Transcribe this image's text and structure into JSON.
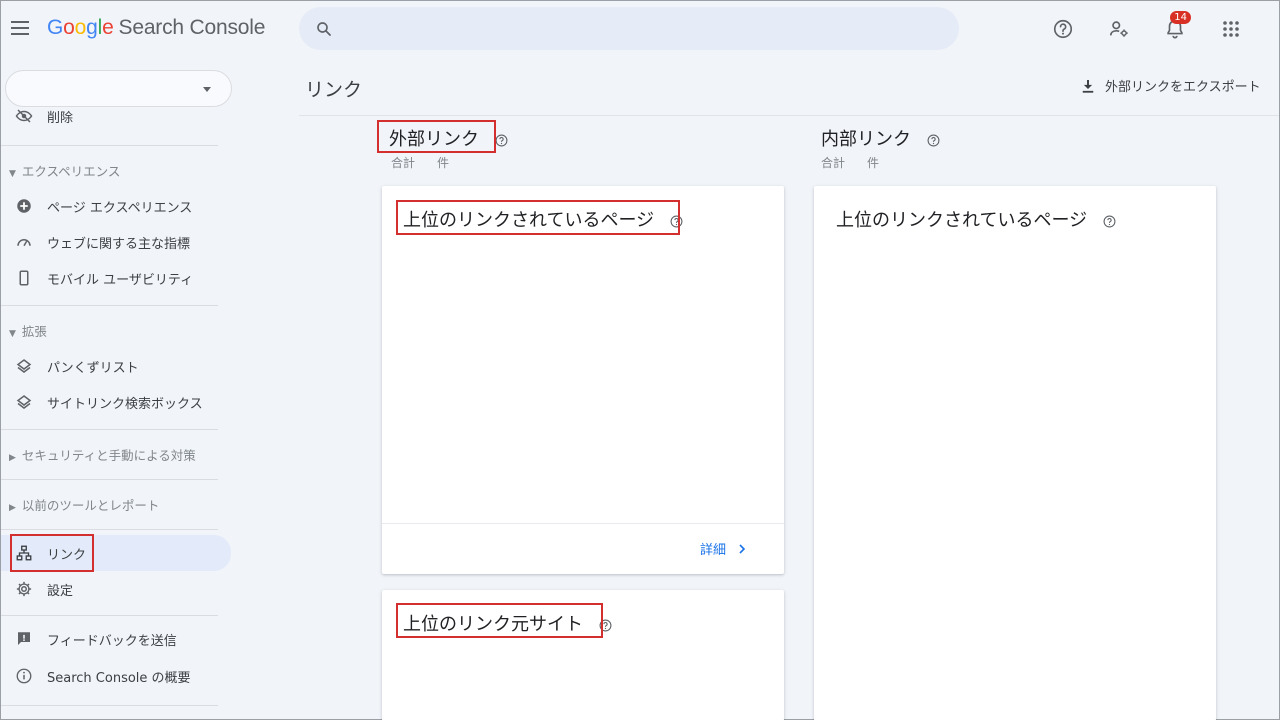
{
  "app": {
    "logo_letters": [
      "G",
      "o",
      "o",
      "g",
      "l",
      "e"
    ],
    "product": "Search Console"
  },
  "search": {
    "placeholder": ""
  },
  "header": {
    "notifications_count": "14"
  },
  "sidebar": {
    "property": "",
    "items": {
      "removals": "削除",
      "experience_section": "エクスペリエンス",
      "page_experience": "ページ エクスペリエンス",
      "core_web_vitals": "ウェブに関する主な指標",
      "mobile_usability": "モバイル ユーザビリティ",
      "enhancements_section": "拡張",
      "breadcrumbs": "パンくずリスト",
      "sitelinks_searchbox": "サイトリンク検索ボックス",
      "security_section": "セキュリティと手動による対策",
      "legacy_section": "以前のツールとレポート",
      "links": "リンク",
      "settings": "設定",
      "feedback": "フィードバックを送信",
      "about": "Search Console の概要"
    }
  },
  "main": {
    "title": "リンク",
    "export_label": "外部リンクをエクスポート",
    "external": {
      "title": "外部リンク",
      "total_label": "合計",
      "unit": "件",
      "top_linked_pages": "上位のリンクされているページ",
      "more_label": "詳細",
      "top_linking_sites": "上位のリンク元サイト"
    },
    "internal": {
      "title": "内部リンク",
      "total_label": "合計",
      "unit": "件",
      "top_linked_pages": "上位のリンクされているページ"
    }
  }
}
